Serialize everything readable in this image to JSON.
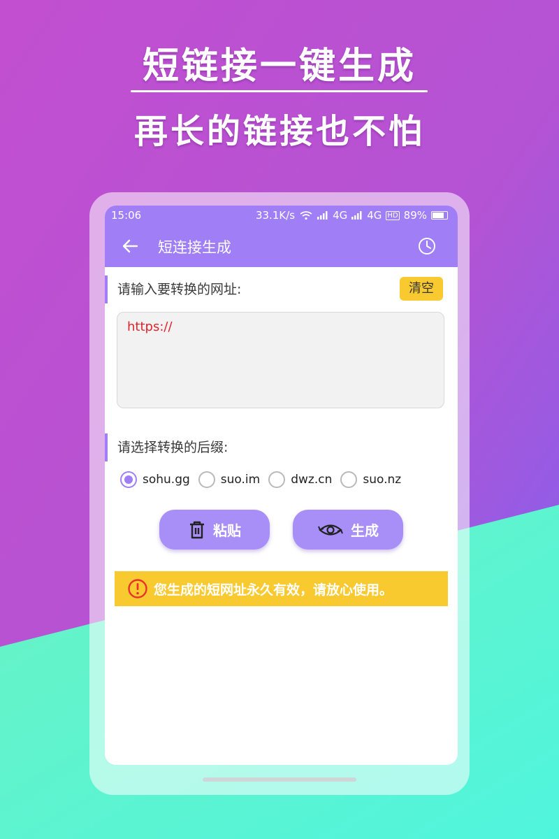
{
  "promo": {
    "headline": "短链接一键生成",
    "subheadline": "再长的链接也不怕"
  },
  "status_bar": {
    "time": "15:06",
    "speed": "33.1K/s",
    "net1": "4G",
    "net2": "4G",
    "hd": "HD",
    "battery": "89%"
  },
  "app_bar": {
    "title": "短连接生成",
    "back_icon": "arrow-left-icon",
    "history_icon": "clock-icon"
  },
  "input_section": {
    "label": "请输入要转换的网址:",
    "clear_label": "清空",
    "value": "https://"
  },
  "suffix_section": {
    "label": "请选择转换的后缀:",
    "options": [
      "sohu.gg",
      "suo.im",
      "dwz.cn",
      "suo.nz"
    ],
    "selected": "sohu.gg"
  },
  "buttons": {
    "paste_label": "粘贴",
    "paste_icon": "trash-icon",
    "generate_label": "生成",
    "generate_icon": "eye-refresh-icon"
  },
  "notice": {
    "text": "您生成的短网址永久有效，请放心使用。",
    "icon": "warning-icon"
  },
  "colors": {
    "accent": "#a07ef6",
    "button": "#a88ef7",
    "warning": "#f9c930",
    "input_text": "#e0232a"
  }
}
